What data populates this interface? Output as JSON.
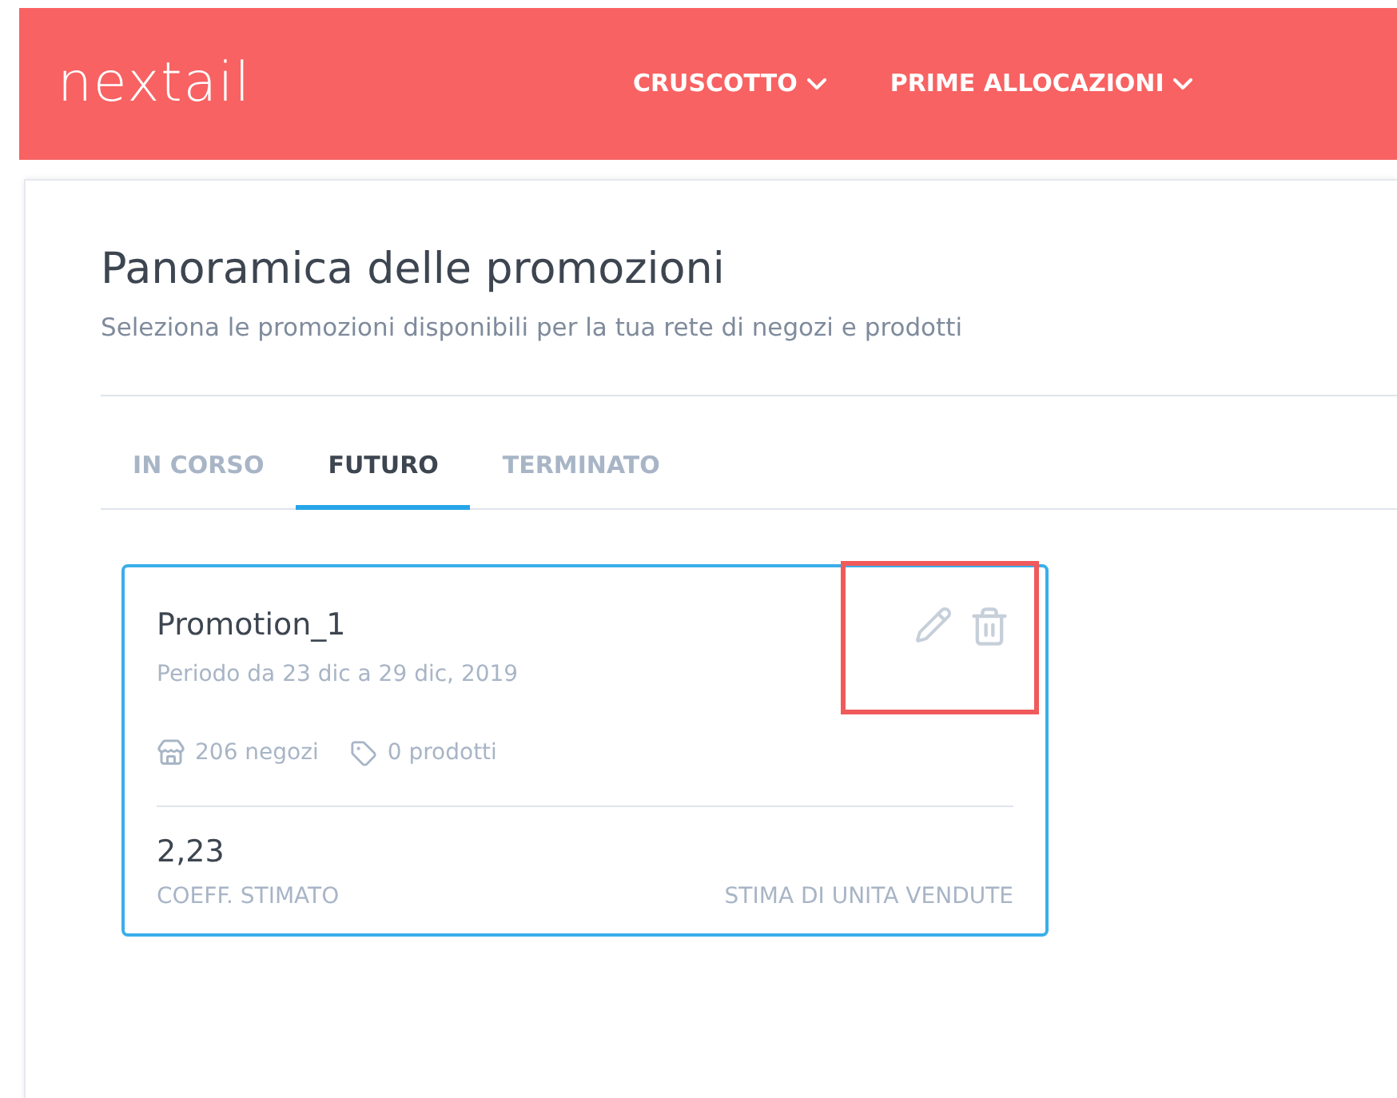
{
  "header": {
    "logo": "nextail",
    "nav": [
      {
        "label": "CRUSCOTTO"
      },
      {
        "label": "PRIME ALLOCAZIONI"
      }
    ]
  },
  "page": {
    "title": "Panoramica delle promozioni",
    "subtitle": "Seleziona le promozioni disponibili per la tua rete di negozi e prodotti"
  },
  "tabs": [
    {
      "label": "IN CORSO",
      "selected": false
    },
    {
      "label": "FUTURO",
      "selected": true
    },
    {
      "label": "TERMINATO",
      "selected": false
    }
  ],
  "promotions": [
    {
      "name": "Promotion_1",
      "period": "Periodo da 23 dic a 29 dic, 2019",
      "stores": "206 negozi",
      "products": "0 prodotti",
      "coefficient": "2,23",
      "coefficient_label": "COEFF. STIMATO",
      "units_label": "STIMA DI UNITA VENDUTE",
      "highlighted_actions": true
    }
  ]
}
